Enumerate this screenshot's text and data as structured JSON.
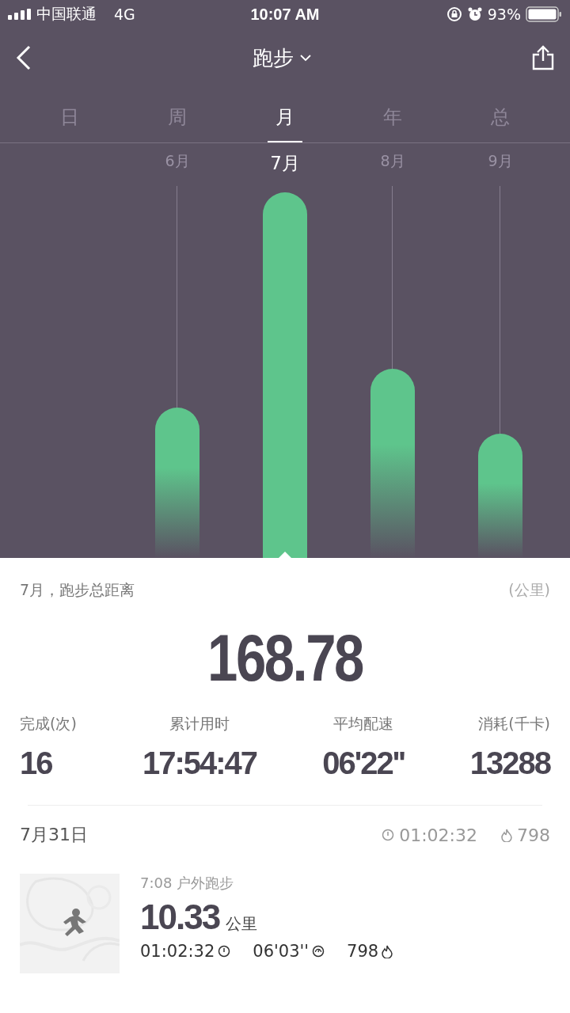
{
  "status_bar": {
    "carrier": "中国联通",
    "network": "4G",
    "time": "10:07 AM",
    "battery": "93%"
  },
  "nav": {
    "title": "跑步"
  },
  "tabs": [
    {
      "label": "日",
      "selected": false
    },
    {
      "label": "周",
      "selected": false
    },
    {
      "label": "月",
      "selected": true
    },
    {
      "label": "年",
      "selected": false
    },
    {
      "label": "总",
      "selected": false
    }
  ],
  "months": [
    {
      "label": "6月",
      "selected": false
    },
    {
      "label": "7月",
      "selected": true
    },
    {
      "label": "8月",
      "selected": false
    },
    {
      "label": "9月",
      "selected": false
    }
  ],
  "summary": {
    "caption": "7月，跑步总距离",
    "unit": "(公里)",
    "total": "168.78"
  },
  "stats": [
    {
      "label": "完成(次)",
      "value": "16"
    },
    {
      "label": "累计用时",
      "value": "17:54:47"
    },
    {
      "label": "平均配速",
      "value": "06'22''"
    },
    {
      "label": "消耗(千卡)",
      "value": "13288"
    }
  ],
  "day": {
    "date": "7月31日",
    "duration": "01:02:32",
    "calories": "798"
  },
  "activity": {
    "time_type": "7:08 户外跑步",
    "distance": "10.33",
    "unit": "公里",
    "duration": "01:02:32",
    "pace": "06'03''",
    "calories": "798"
  }
}
